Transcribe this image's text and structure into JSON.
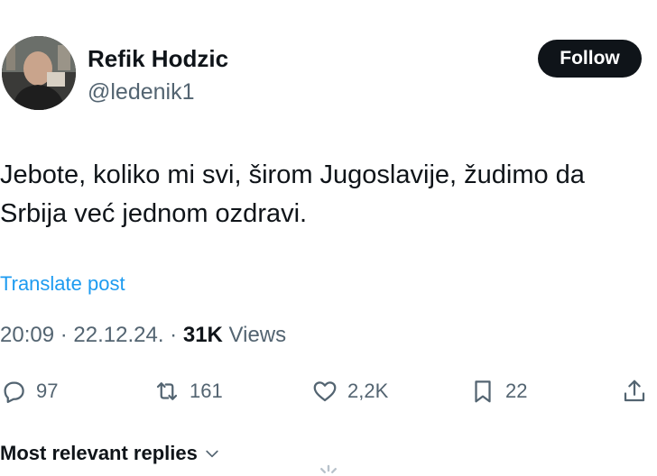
{
  "author": {
    "name": "Refik Hodzic",
    "handle": "@ledenik1"
  },
  "follow_button": {
    "label": "Follow"
  },
  "post": {
    "text": "Jebote, koliko mi svi, širom Jugoslavije, žudimo da Srbija već jednom ozdravi.",
    "translate_label": "Translate post"
  },
  "meta": {
    "time": "20:09",
    "separator": "·",
    "date": "22.12.24.",
    "views_count": "31K",
    "views_label": "Views"
  },
  "actions": {
    "replies": "97",
    "reposts": "161",
    "likes": "2,2K",
    "bookmarks": "22"
  },
  "replies_sort": {
    "label": "Most relevant replies"
  },
  "colors": {
    "text": "#0f1419",
    "secondary": "#536471",
    "link": "#1d9bf0",
    "button": "#0f1419"
  },
  "icons": {
    "reply": "speech-bubble-icon",
    "repost": "repost-arrows-icon",
    "like": "heart-icon",
    "bookmark": "bookmark-icon",
    "share": "share-upload-icon",
    "sort": "chevron-down-icon"
  }
}
